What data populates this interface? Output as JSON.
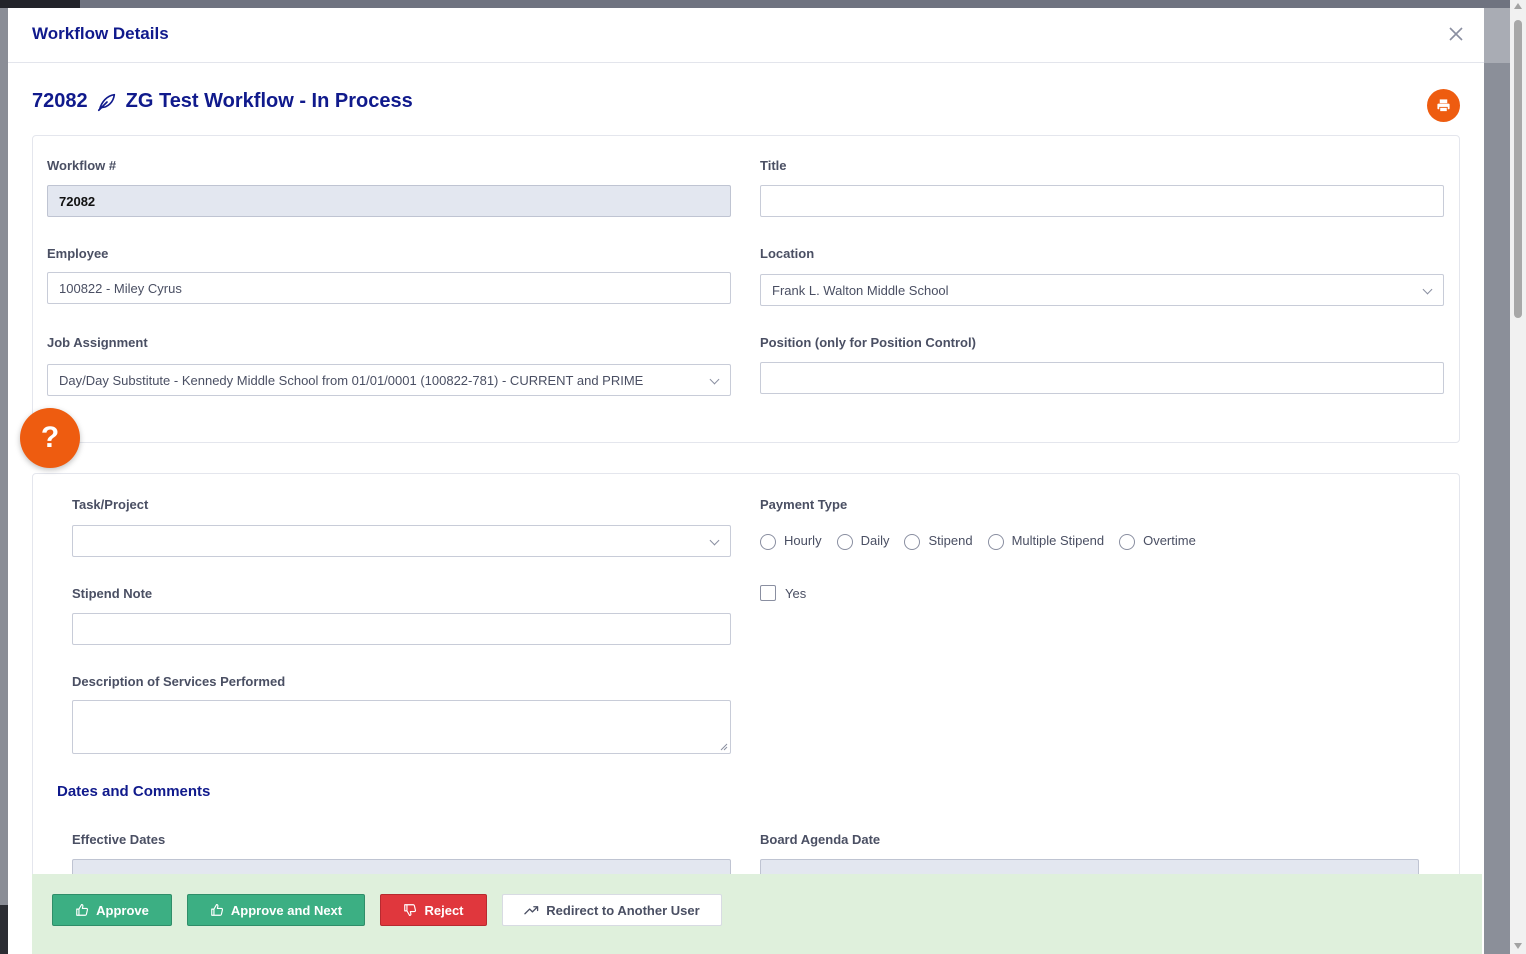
{
  "modal": {
    "title": "Workflow Details"
  },
  "workflow": {
    "number": "72082",
    "heading": "ZG Test Workflow - In Process"
  },
  "form": {
    "workflow_label": "Workflow #",
    "workflow_value": "72082",
    "title_label": "Title",
    "title_value": "",
    "employee_label": "Employee",
    "employee_value": "100822 - Miley Cyrus",
    "location_label": "Location",
    "location_value": "Frank L. Walton Middle School",
    "job_label": "Job Assignment",
    "job_value": "Day/Day Substitute - Kennedy Middle School from 01/01/0001 (100822-781) - CURRENT and PRIME",
    "position_label": "Position (only for Position Control)",
    "position_value": ""
  },
  "details": {
    "task_label": "Task/Project",
    "task_value": "",
    "payment_label": "Payment Type",
    "payment_options": [
      "Hourly",
      "Daily",
      "Stipend",
      "Multiple Stipend",
      "Overtime"
    ],
    "stipend_note_label": "Stipend Note",
    "stipend_note_value": "",
    "yes_label": "Yes",
    "description_label": "Description of Services Performed",
    "description_value": "",
    "dates_section_title": "Dates and Comments",
    "effective_dates_label": "Effective Dates",
    "board_agenda_label": "Board Agenda Date"
  },
  "help": {
    "icon_text": "?"
  },
  "actions": {
    "approve": "Approve",
    "approve_next": "Approve and Next",
    "reject": "Reject",
    "redirect": "Redirect to Another User"
  },
  "colors": {
    "heading": "#101a8c",
    "accent_orange": "#ee5c10",
    "approve_green": "#3caf83",
    "reject_red": "#e0373d",
    "action_bar": "#dff0dc"
  },
  "icons": {
    "close": "close-icon",
    "leaf": "leaf-icon",
    "print": "printer-icon",
    "help": "question-icon",
    "thumbs_up": "thumbs-up-icon",
    "thumbs_down": "thumbs-down-icon",
    "redirect": "trending-up-icon"
  }
}
